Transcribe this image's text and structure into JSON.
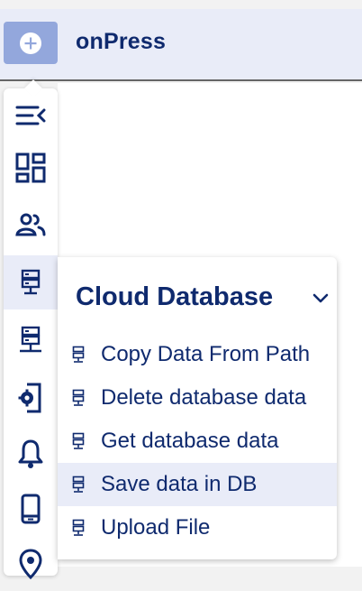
{
  "app": {
    "title": "onPress"
  },
  "icons": {
    "logo": "plus-circle-icon",
    "rail": [
      "collapse-menu-icon",
      "dashboard-grid-icon",
      "users-icon",
      "database-icon",
      "database-export-icon",
      "settings-device-icon",
      "bell-icon",
      "mobile-phone-icon",
      "location-pin-icon"
    ],
    "menu_item": "database-icon",
    "section_toggle": "chevron-down-icon"
  },
  "flyout": {
    "title": "Cloud Database",
    "items": [
      {
        "label": "Copy Data From Path"
      },
      {
        "label": "Delete database data"
      },
      {
        "label": "Get database data"
      },
      {
        "label": "Save data in DB",
        "highlighted": true
      },
      {
        "label": "Upload File"
      }
    ]
  },
  "colors": {
    "brand_navy": "#0f2a6e",
    "accent_blue": "#93a7dc",
    "highlight": "#e9ecf8"
  }
}
